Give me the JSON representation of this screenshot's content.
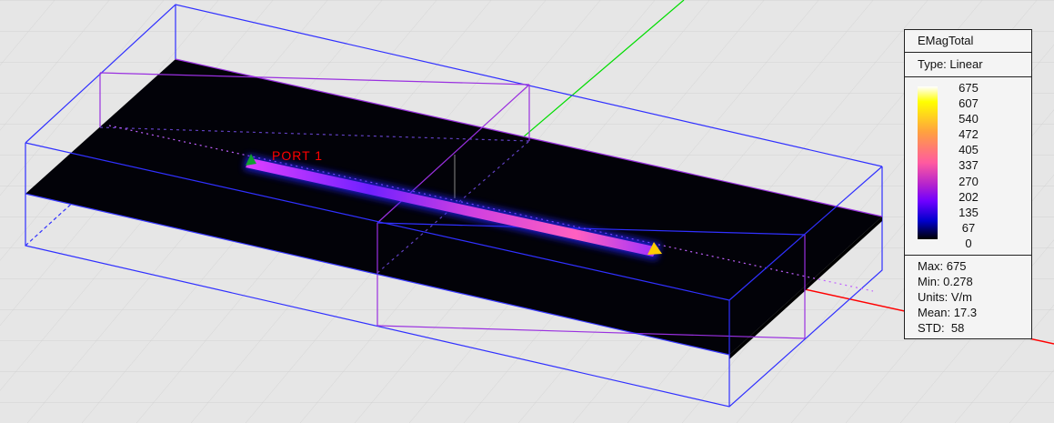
{
  "legend": {
    "title": "EMagTotal",
    "type": "Type: Linear",
    "ticks": [
      "675",
      "607",
      "540",
      "472",
      "405",
      "337",
      "270",
      "202",
      "135",
      "67",
      "0"
    ],
    "stats": {
      "max": "Max: 675",
      "min": "Min: 0.278",
      "units": "Units: V/m",
      "mean": "Mean: 17.3",
      "std": "STD:  58"
    }
  },
  "scene": {
    "port_label": "PORT 1",
    "colors": {
      "airbox": "#3030ff",
      "substrate_box": "#9a30e0",
      "x_axis": "#ff0000",
      "y_axis": "#00dd00",
      "plane": "#000000"
    }
  }
}
